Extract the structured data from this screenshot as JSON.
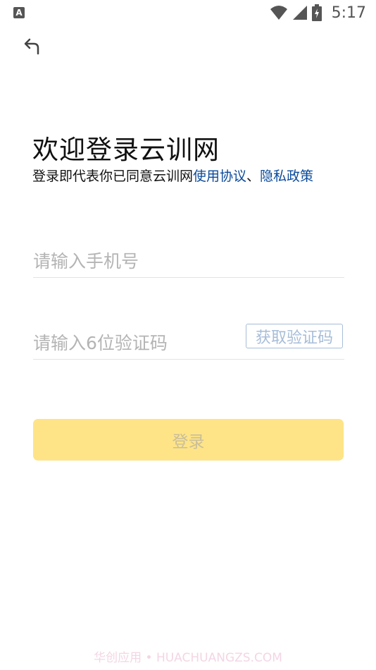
{
  "status_bar": {
    "app_badge": "A",
    "time": "5:17"
  },
  "page": {
    "title": "欢迎登录云训网",
    "agreement_prefix": "登录即代表你已同意云训网",
    "terms_link": "使用协议",
    "separator": "、",
    "privacy_link": "隐私政策"
  },
  "form": {
    "phone_placeholder": "请输入手机号",
    "code_placeholder": "请输入6位验证码",
    "get_code_label": "获取验证码",
    "login_label": "登录"
  },
  "watermark": "华创应用 • HUACHUANGZS.COM",
  "colors": {
    "link": "#0a4a9a",
    "login_button": "#fee487",
    "code_button_border": "#a7bdd8"
  }
}
